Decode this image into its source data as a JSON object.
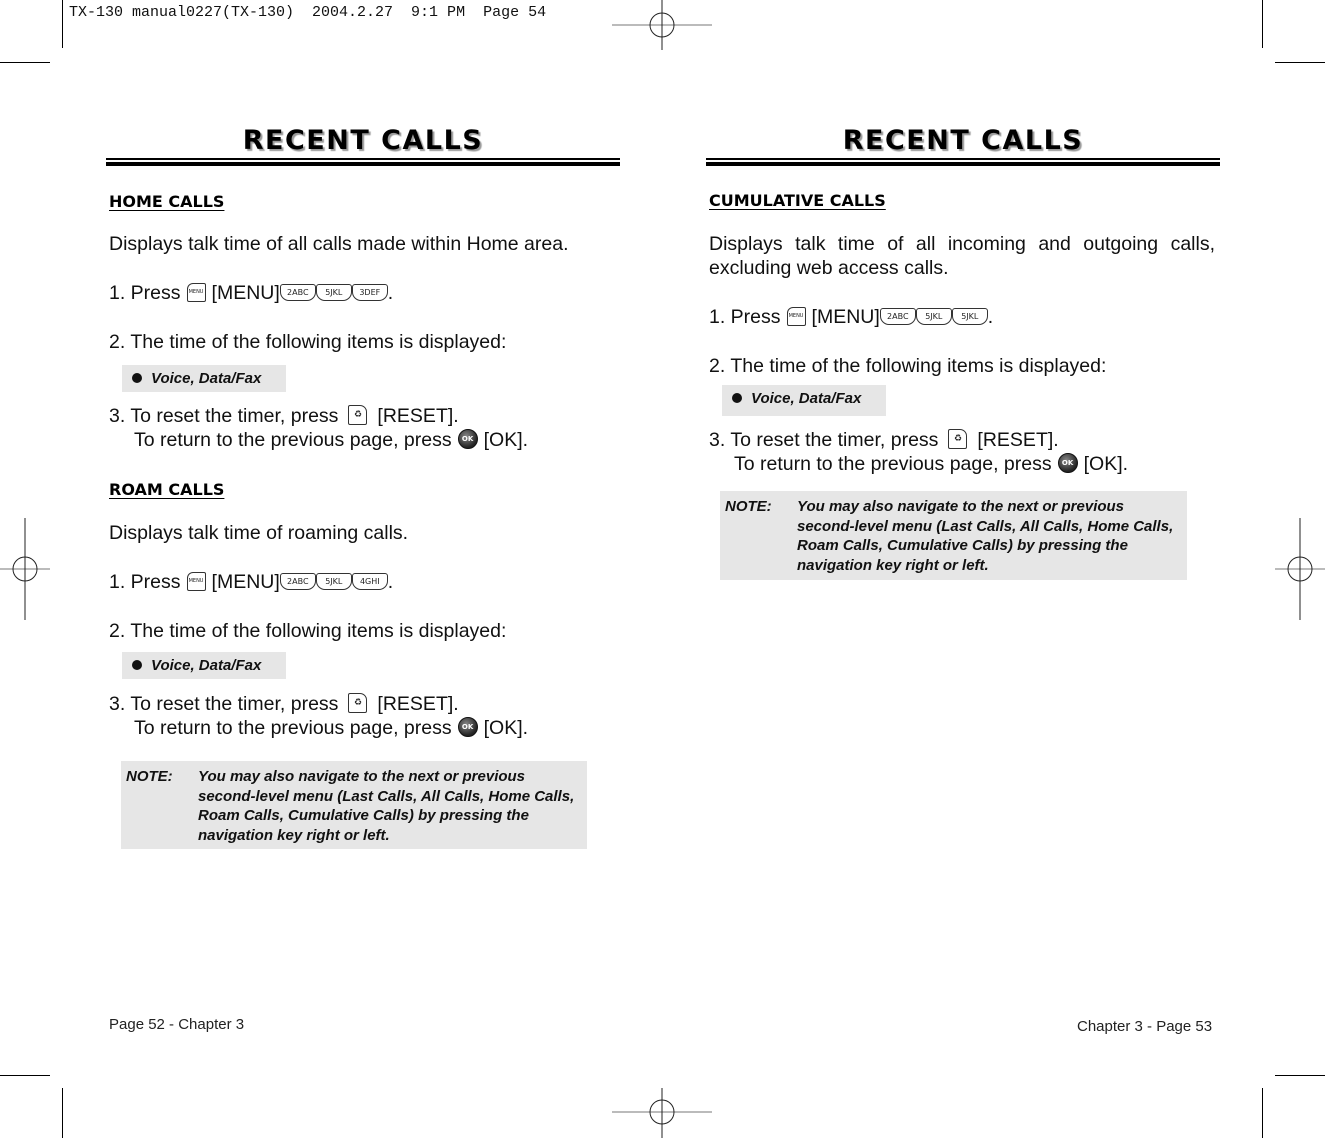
{
  "slug": "TX-130 manual0227(TX-130)  2004.2.27  9:1 PM  Page 54",
  "left_page": {
    "title": "RECENT CALLS",
    "sections": [
      {
        "heading": "HOME CALLS",
        "description": "Displays talk time of all calls made within Home area.",
        "step1": {
          "prefix": "1. Press",
          "menu_key": "MENU",
          "menu_label": "[MENU]",
          "keys": [
            "2ABC",
            "5JKL",
            "3DEF"
          ],
          "suffix": "."
        },
        "step2": "2. The time of the following items is displayed:",
        "bullet": "Voice, Data/Fax",
        "step3_line1": {
          "prefix": "3. To reset the timer, press",
          "label": "[RESET]."
        },
        "step3_line2": {
          "prefix": "To return to the previous page, press",
          "key": "OK",
          "label": "[OK]."
        }
      },
      {
        "heading": "ROAM CALLS",
        "description": "Displays talk time of roaming calls.",
        "step1": {
          "prefix": "1. Press",
          "menu_key": "MENU",
          "menu_label": "[MENU]",
          "keys": [
            "2ABC",
            "5JKL",
            "4GHI"
          ],
          "suffix": "."
        },
        "step2": "2. The time of the following items is displayed:",
        "bullet": "Voice, Data/Fax",
        "step3_line1": {
          "prefix": "3. To reset the timer, press",
          "label": "[RESET]."
        },
        "step3_line2": {
          "prefix": "To return to the previous page, press",
          "key": "OK",
          "label": "[OK]."
        }
      }
    ],
    "note": {
      "label": "NOTE:",
      "text": "You may also navigate to the next or previous second-level menu (Last Calls, All Calls, Home Calls, Roam Calls, Cumulative Calls) by pressing the navigation key right or left."
    },
    "footer": "Page 52 - Chapter 3"
  },
  "right_page": {
    "title": "RECENT CALLS",
    "section": {
      "heading": "CUMULATIVE CALLS",
      "description": "Displays talk time of all incoming and outgoing calls, excluding web access calls.",
      "step1": {
        "prefix": "1. Press",
        "menu_key": "MENU",
        "menu_label": "[MENU]",
        "keys": [
          "2ABC",
          "5JKL",
          "5JKL"
        ],
        "suffix": "."
      },
      "step2": "2. The time of the following items is displayed:",
      "bullet": "Voice, Data/Fax",
      "step3_line1": {
        "prefix": "3. To reset the timer, press",
        "label": "[RESET]."
      },
      "step3_line2": {
        "prefix": "To return to the previous page, press",
        "key": "OK",
        "label": "[OK]."
      }
    },
    "note": {
      "label": "NOTE:",
      "text": "You may also navigate to the next or previous second-level menu (Last Calls, All Calls, Home Calls, Roam Calls, Cumulative Calls) by pressing the navigation key right or left."
    },
    "footer": "Chapter 3 - Page 53"
  },
  "colors": {
    "shade": "#e6e6e6",
    "ink": "#111111",
    "title_shadow": "#9a9a9a"
  }
}
